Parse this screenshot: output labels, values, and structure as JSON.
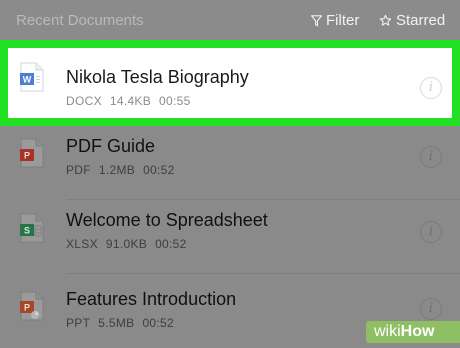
{
  "header": {
    "title": "Recent Documents",
    "filter_label": "Filter",
    "starred_label": "Starred",
    "filter_icon": "filter-funnel-icon",
    "starred_icon": "star-outline-icon"
  },
  "documents": [
    {
      "name": "Nikola Tesla Biography",
      "type": "DOCX",
      "size": "14.4KB",
      "time": "00:55",
      "icon": "word-document-icon",
      "icon_letter": "W",
      "icon_color": "#4a7fd4",
      "selected": true
    },
    {
      "name": "PDF Guide",
      "type": "PDF",
      "size": "1.2MB",
      "time": "00:52",
      "icon": "pdf-document-icon",
      "icon_letter": "P",
      "icon_color": "#c0392b",
      "selected": false
    },
    {
      "name": "Welcome to Spreadsheet",
      "type": "XLSX",
      "size": "91.0KB",
      "time": "00:52",
      "icon": "spreadsheet-document-icon",
      "icon_letter": "S",
      "icon_color": "#2e8b57",
      "selected": false
    },
    {
      "name": "Features Introduction",
      "type": "PPT",
      "size": "5.5MB",
      "time": "00:52",
      "icon": "presentation-document-icon",
      "icon_letter": "P",
      "icon_color": "#c0502b",
      "selected": false
    }
  ],
  "info_icon": "info-circle-icon",
  "info_glyph": "i",
  "colors": {
    "highlight": "#22e022",
    "dim_background": "#8a8a8a"
  },
  "watermark": {
    "prefix": "wiki",
    "suffix": "How"
  }
}
